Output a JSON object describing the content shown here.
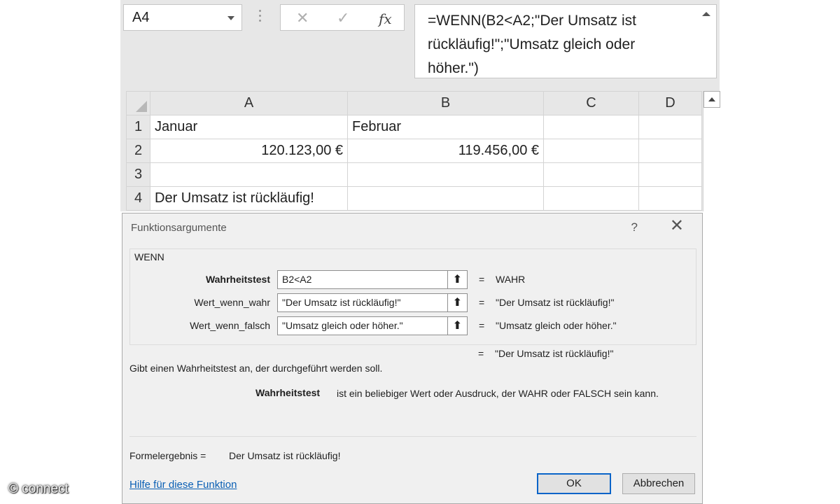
{
  "formula_bar": {
    "name_box": "A4",
    "cancel_icon": "✕",
    "enter_icon": "✓",
    "fx_icon": "fx",
    "formula_lines": [
      "=WENN(B2<A2;\"Der Umsatz ist",
      "rückläufig!\";\"Umsatz gleich oder",
      "höher.\")"
    ]
  },
  "sheet": {
    "columns": [
      "A",
      "B",
      "C",
      "D"
    ],
    "rows": [
      {
        "num": "1",
        "cells": [
          "Januar",
          "Februar",
          "",
          ""
        ]
      },
      {
        "num": "2",
        "cells": [
          "120.123,00 €",
          "119.456,00 €",
          "",
          ""
        ]
      },
      {
        "num": "3",
        "cells": [
          "",
          "",
          "",
          ""
        ]
      },
      {
        "num": "4",
        "cells": [
          "Der Umsatz ist rückläufig!",
          "",
          "",
          ""
        ]
      }
    ]
  },
  "dialog": {
    "title": "Funktionsargumente",
    "help": "?",
    "close": "✕",
    "function_name": "WENN",
    "args": [
      {
        "label": "Wahrheitstest",
        "value": "B2<A2",
        "result": "WAHR"
      },
      {
        "label": "Wert_wenn_wahr",
        "value": "\"Der Umsatz ist rückläufig!\"",
        "result": "\"Der Umsatz ist rückläufig!\""
      },
      {
        "label": "Wert_wenn_falsch",
        "value": "\"Umsatz gleich oder höher.\"",
        "result": "\"Umsatz gleich oder höher.\""
      }
    ],
    "eq": "=",
    "final_result": "\"Der Umsatz ist rückläufig!\"",
    "description": "Gibt einen Wahrheitstest an, der durchgeführt werden soll.",
    "param_name": "Wahrheitstest",
    "param_description": "ist ein beliebiger Wert oder Ausdruck, der WAHR oder FALSCH sein kann.",
    "formula_result_label": "Formelergebnis =",
    "formula_result_value": "Der Umsatz ist rückläufig!",
    "help_link": "Hilfe für diese Funktion",
    "ok": "OK",
    "cancel": "Abbrechen",
    "pick_icon": "⬆"
  },
  "watermark": "© connect"
}
